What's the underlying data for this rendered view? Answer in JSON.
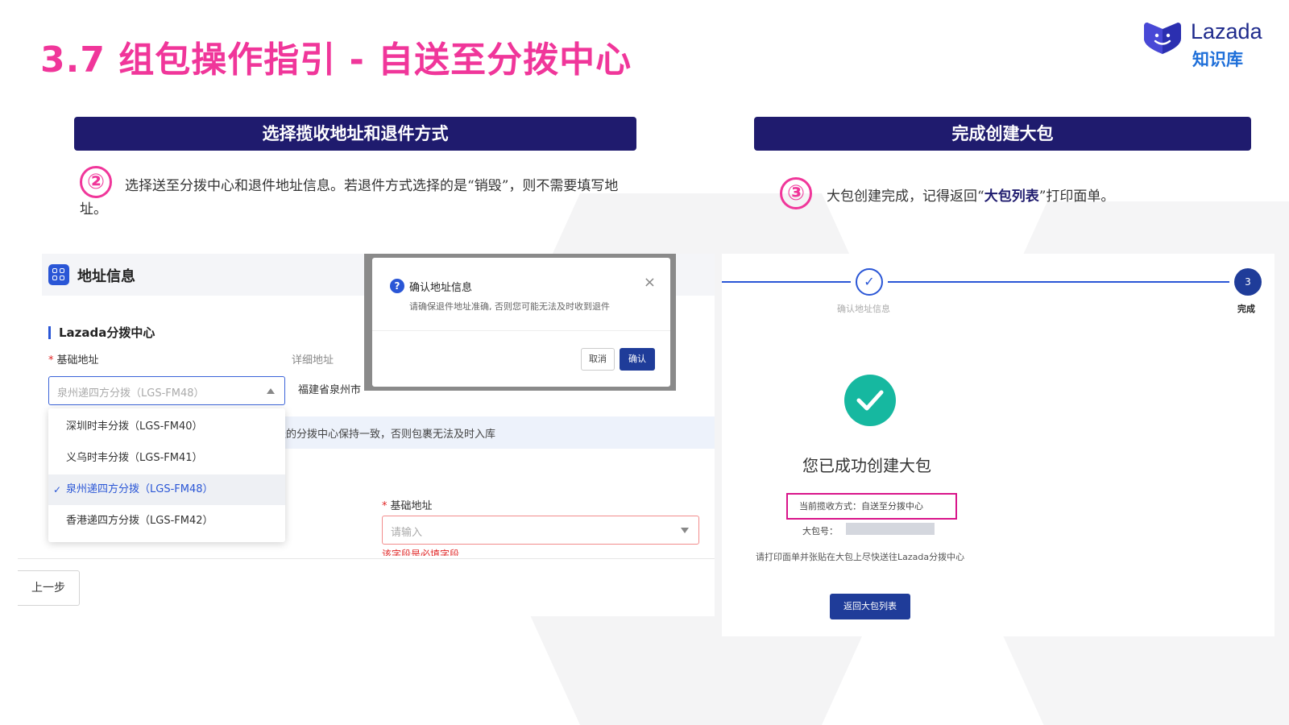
{
  "title": "3.7 组包操作指引 - 自送至分拨中心",
  "logo": {
    "wordmark": "Lazada",
    "subtitle": "知识库"
  },
  "left_section": {
    "header": "选择揽收地址和退件方式",
    "step_number": "②",
    "description": "选择送至分拨中心和退件地址信息。若退件方式选择的是“销毁”，则不需要填写地址。"
  },
  "right_section": {
    "header": "完成创建大包",
    "step_number": "③",
    "description_prefix": "大包创建完成，记得返回“",
    "description_bold": "大包列表",
    "description_suffix": "”打印面单。"
  },
  "address_form": {
    "section_title": "地址信息",
    "subsection_title": "Lazada分拨中心",
    "base_address_label": "基础地址",
    "base_address_placeholder": "泉州递四方分拨（LGS-FM48）",
    "detail_address_label": "详细地址",
    "detail_address_value": "福建省泉州市",
    "notice_text": "送的分拨中心保持一致，否则包裹无法及时入库",
    "dropdown_options": [
      {
        "label": "深圳时丰分拨（LGS-FM40）",
        "selected": false
      },
      {
        "label": "义乌时丰分拨（LGS-FM41）",
        "selected": false
      },
      {
        "label": "泉州递四方分拨（LGS-FM48）",
        "selected": true
      },
      {
        "label": "香港递四方分拨（LGS-FM42）",
        "selected": false
      }
    ],
    "return_base_address_label": "基础地址",
    "return_base_address_placeholder": "请输入",
    "required_error": "该字段是必填字段",
    "prev_button": "上一步"
  },
  "confirm_modal": {
    "title": "确认地址信息",
    "message": "请确保退件地址准确, 否则您可能无法及时收到退件",
    "cancel": "取消",
    "confirm": "确认",
    "close_icon": "×"
  },
  "result_panel": {
    "step_completed_label": "确认地址信息",
    "step_completed_mark": "✓",
    "step_current_number": "3",
    "step_current_label": "完成",
    "success_message": "您已成功创建大包",
    "pickup_method": "当前揽收方式：自送至分拨中心",
    "package_no_label": "大包号：",
    "instruction": "请打印面单并张贴在大包上尽快送往Lazada分拨中心",
    "return_button": "返回大包列表"
  },
  "colors": {
    "title_pink": "#f0369a",
    "header_navy": "#1f1b6e",
    "primary_blue": "#1f3c99",
    "success_teal": "#16b8a0",
    "highlight_magenta": "#d9148a"
  },
  "icons": [
    "lazada-logo-icon",
    "grid-icon",
    "chevron-up-icon",
    "chevron-down-icon",
    "check-icon",
    "question-icon",
    "close-icon",
    "success-check-icon"
  ]
}
